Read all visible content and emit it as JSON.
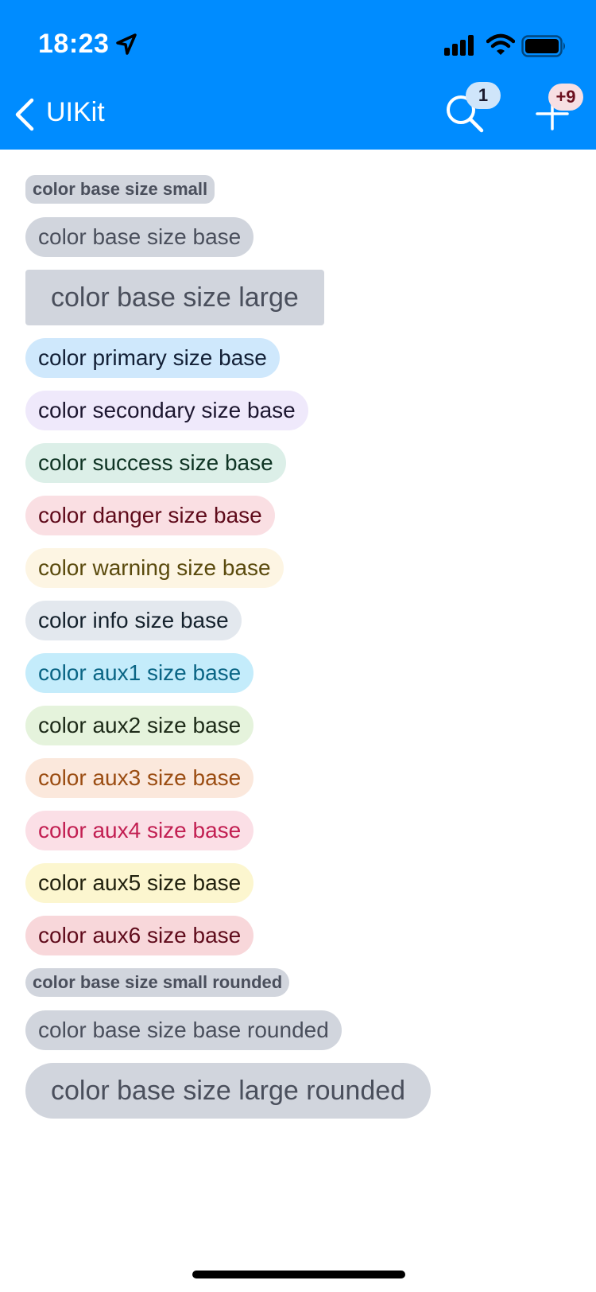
{
  "status_bar": {
    "time": "18:23",
    "icons": [
      "location-arrow-icon",
      "cellular-signal-icon",
      "wifi-icon",
      "battery-icon"
    ]
  },
  "nav": {
    "title": "UIKit",
    "back_icon": "chevron-left-icon",
    "search_badge": "1",
    "add_badge": "+9"
  },
  "colors": {
    "header_bg": "#008cff"
  },
  "tags": [
    {
      "label": "color base size small",
      "color": "base",
      "size": "small",
      "rounded": false,
      "bg": "#d1d5dd",
      "fg": "#4a4f5c"
    },
    {
      "label": "color base size base",
      "color": "base",
      "size": "base",
      "rounded": false,
      "bg": "#d1d5dd",
      "fg": "#4a4f5c"
    },
    {
      "label": "color base size large",
      "color": "base",
      "size": "large",
      "rounded": false,
      "bg": "#d1d5dd",
      "fg": "#4a4f5c"
    },
    {
      "label": "color primary size base",
      "color": "primary",
      "size": "base",
      "rounded": false,
      "bg": "#cfe8fc",
      "fg": "#132036"
    },
    {
      "label": "color secondary size base",
      "color": "secondary",
      "size": "base",
      "rounded": false,
      "bg": "#efe9fb",
      "fg": "#1d1730"
    },
    {
      "label": "color success size base",
      "color": "success",
      "size": "base",
      "rounded": false,
      "bg": "#dcefe8",
      "fg": "#0f3424"
    },
    {
      "label": "color danger size base",
      "color": "danger",
      "size": "base",
      "rounded": false,
      "bg": "#fadfe3",
      "fg": "#5f0b1b"
    },
    {
      "label": "color warning size base",
      "color": "warning",
      "size": "base",
      "rounded": false,
      "bg": "#fdf5e3",
      "fg": "#5a4a0d"
    },
    {
      "label": "color info size base",
      "color": "info",
      "size": "base",
      "rounded": false,
      "bg": "#e3e8ee",
      "fg": "#15222d"
    },
    {
      "label": "color aux1 size base",
      "color": "aux1",
      "size": "base",
      "rounded": false,
      "bg": "#c4ecfb",
      "fg": "#0a6585"
    },
    {
      "label": "color aux2 size base",
      "color": "aux2",
      "size": "base",
      "rounded": false,
      "bg": "#e5f3dc",
      "fg": "#1d2a18"
    },
    {
      "label": "color aux3 size base",
      "color": "aux3",
      "size": "base",
      "rounded": false,
      "bg": "#fbe8dc",
      "fg": "#9b4d12"
    },
    {
      "label": "color aux4 size base",
      "color": "aux4",
      "size": "base",
      "rounded": false,
      "bg": "#fbdfe6",
      "fg": "#c21f52"
    },
    {
      "label": "color aux5 size base",
      "color": "aux5",
      "size": "base",
      "rounded": false,
      "bg": "#fcf6cf",
      "fg": "#22220f"
    },
    {
      "label": "color aux6 size base",
      "color": "aux6",
      "size": "base",
      "rounded": false,
      "bg": "#f8d7da",
      "fg": "#5f0b1b"
    },
    {
      "label": "color base size small rounded",
      "color": "base",
      "size": "small",
      "rounded": true,
      "bg": "#d1d5dd",
      "fg": "#4a4f5c"
    },
    {
      "label": "color base size base rounded",
      "color": "base",
      "size": "base",
      "rounded": true,
      "bg": "#d1d5dd",
      "fg": "#4a4f5c"
    },
    {
      "label": "color base size large rounded",
      "color": "base",
      "size": "large",
      "rounded": true,
      "bg": "#d1d5dd",
      "fg": "#4a4f5c"
    }
  ]
}
